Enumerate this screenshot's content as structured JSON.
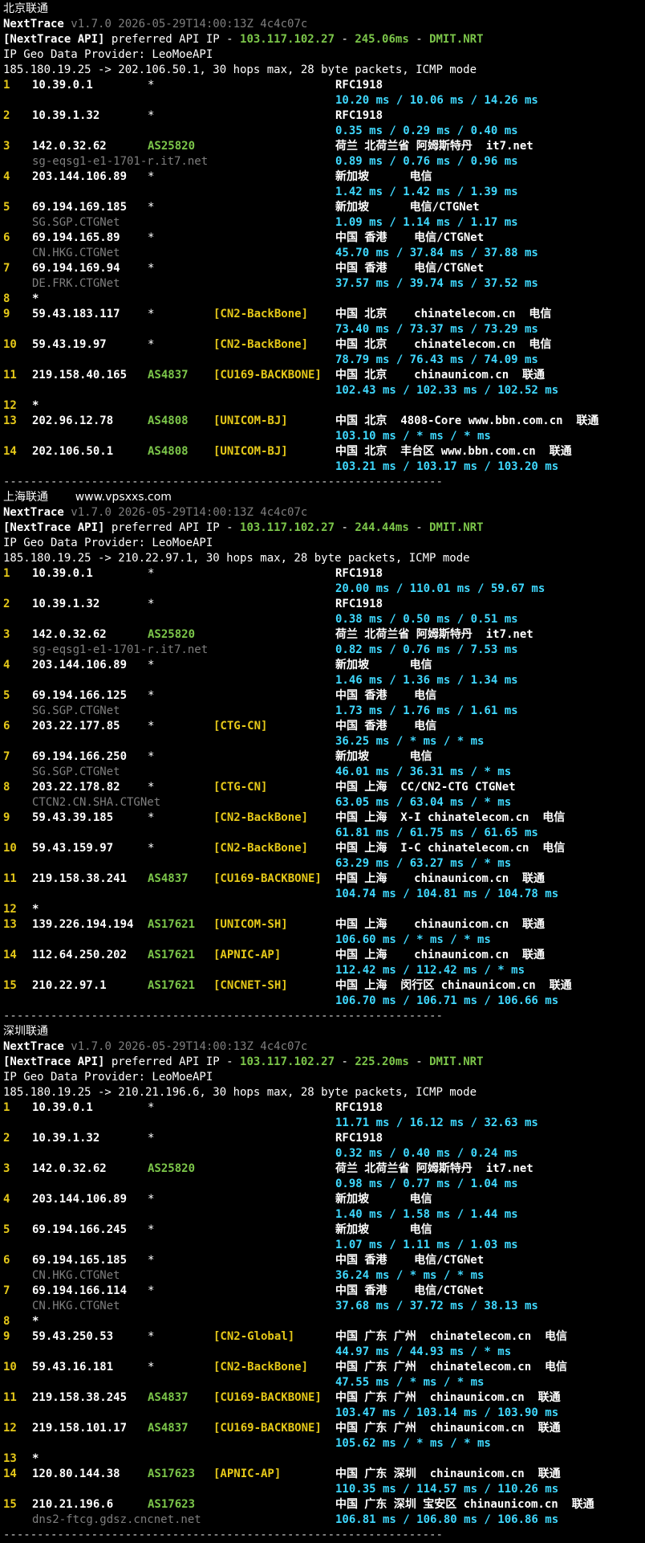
{
  "sections": [
    {
      "title": "北京联通",
      "title_extra": "",
      "nt_name": "NextTrace",
      "nt_version": "v1.7.0 2026-05-29T14:00:13Z 4c4c07c",
      "api_prefix": "[NextTrace API]",
      "api_mid": " preferred API IP - ",
      "api_ip": "103.117.102.27",
      "api_dash1": " - ",
      "api_latency": "245.06ms",
      "api_dash2": " - ",
      "api_node": "DMIT.NRT",
      "geo_provider": "IP Geo Data Provider: LeoMoeAPI",
      "trace_line": "185.180.19.25 -> 202.106.50.1, 30 hops max, 28 byte packets, ICMP mode",
      "hops": [
        {
          "n": "1",
          "ip": "10.39.0.1",
          "as": "*",
          "tag": "",
          "geo": "RFC1918",
          "host": "",
          "rtt": "10.20 ms / 10.06 ms / 14.26 ms"
        },
        {
          "n": "2",
          "ip": "10.39.1.32",
          "as": "*",
          "tag": "",
          "geo": "RFC1918",
          "host": "",
          "rtt": "0.35 ms / 0.29 ms / 0.40 ms"
        },
        {
          "n": "3",
          "ip": "142.0.32.62",
          "as": "AS25820",
          "tag": "",
          "geo": "荷兰 北荷兰省 阿姆斯特丹  it7.net",
          "host": "sg-eqsg1-e1-1701-r.it7.net",
          "rtt": "0.89 ms / 0.76 ms / 0.96 ms"
        },
        {
          "n": "4",
          "ip": "203.144.106.89",
          "as": "*",
          "tag": "",
          "geo": "新加坡      电信",
          "host": "",
          "rtt": "1.42 ms / 1.42 ms / 1.39 ms"
        },
        {
          "n": "5",
          "ip": "69.194.169.185",
          "as": "*",
          "tag": "",
          "geo": "新加坡      电信/CTGNet",
          "host": "SG.SGP.CTGNet",
          "rtt": "1.09 ms / 1.14 ms / 1.17 ms"
        },
        {
          "n": "6",
          "ip": "69.194.165.89",
          "as": "*",
          "tag": "",
          "geo": "中国 香港    电信/CTGNet",
          "host": "CN.HKG.CTGNet",
          "rtt": "45.70 ms / 37.84 ms / 37.88 ms"
        },
        {
          "n": "7",
          "ip": "69.194.169.94",
          "as": "*",
          "tag": "",
          "geo": "中国 香港    电信/CTGNet",
          "host": "DE.FRK.CTGNet",
          "rtt": "37.57 ms / 39.74 ms / 37.52 ms"
        },
        {
          "n": "8",
          "ip": "*",
          "as": "",
          "tag": "",
          "geo": "",
          "host": "",
          "rtt": ""
        },
        {
          "n": "9",
          "ip": "59.43.183.117",
          "as": "*",
          "tag": "[CN2-BackBone]",
          "geo": "中国 北京    chinatelecom.cn  电信",
          "host": "",
          "rtt": "73.40 ms / 73.37 ms / 73.29 ms"
        },
        {
          "n": "10",
          "ip": "59.43.19.97",
          "as": "*",
          "tag": "[CN2-BackBone]",
          "geo": "中国 北京    chinatelecom.cn  电信",
          "host": "",
          "rtt": "78.79 ms / 76.43 ms / 74.09 ms"
        },
        {
          "n": "11",
          "ip": "219.158.40.165",
          "as": "AS4837",
          "tag": "[CU169-BACKBONE]",
          "geo": "中国 北京    chinaunicom.cn  联通",
          "host": "",
          "rtt": "102.43 ms / 102.33 ms / 102.52 ms"
        },
        {
          "n": "12",
          "ip": "*",
          "as": "",
          "tag": "",
          "geo": "",
          "host": "",
          "rtt": ""
        },
        {
          "n": "13",
          "ip": "202.96.12.78",
          "as": "AS4808",
          "tag": "[UNICOM-BJ]",
          "geo": "中国 北京  4808-Core www.bbn.com.cn  联通",
          "host": "",
          "rtt": "103.10 ms / * ms / * ms"
        },
        {
          "n": "14",
          "ip": "202.106.50.1",
          "as": "AS4808",
          "tag": "[UNICOM-BJ]",
          "geo": "中国 北京  丰台区 www.bbn.com.cn  联通",
          "host": "",
          "rtt": "103.21 ms / 103.17 ms / 103.20 ms"
        }
      ]
    },
    {
      "title": "上海联通",
      "title_extra": "www.vpsxxs.com",
      "nt_name": "NextTrace",
      "nt_version": "v1.7.0 2026-05-29T14:00:13Z 4c4c07c",
      "api_prefix": "[NextTrace API]",
      "api_mid": " preferred API IP - ",
      "api_ip": "103.117.102.27",
      "api_dash1": " - ",
      "api_latency": "244.44ms",
      "api_dash2": " - ",
      "api_node": "DMIT.NRT",
      "geo_provider": "IP Geo Data Provider: LeoMoeAPI",
      "trace_line": "185.180.19.25 -> 210.22.97.1, 30 hops max, 28 byte packets, ICMP mode",
      "hops": [
        {
          "n": "1",
          "ip": "10.39.0.1",
          "as": "*",
          "tag": "",
          "geo": "RFC1918",
          "host": "",
          "rtt": "20.00 ms / 110.01 ms / 59.67 ms"
        },
        {
          "n": "2",
          "ip": "10.39.1.32",
          "as": "*",
          "tag": "",
          "geo": "RFC1918",
          "host": "",
          "rtt": "0.38 ms / 0.50 ms / 0.51 ms"
        },
        {
          "n": "3",
          "ip": "142.0.32.62",
          "as": "AS25820",
          "tag": "",
          "geo": "荷兰 北荷兰省 阿姆斯特丹  it7.net",
          "host": "sg-eqsg1-e1-1701-r.it7.net",
          "rtt": "0.82 ms / 0.76 ms / 7.53 ms"
        },
        {
          "n": "4",
          "ip": "203.144.106.89",
          "as": "*",
          "tag": "",
          "geo": "新加坡      电信",
          "host": "",
          "rtt": "1.46 ms / 1.36 ms / 1.34 ms"
        },
        {
          "n": "5",
          "ip": "69.194.166.125",
          "as": "*",
          "tag": "",
          "geo": "中国 香港    电信",
          "host": "SG.SGP.CTGNet",
          "rtt": "1.73 ms / 1.76 ms / 1.61 ms"
        },
        {
          "n": "6",
          "ip": "203.22.177.85",
          "as": "*",
          "tag": "[CTG-CN]",
          "geo": "中国 香港    电信",
          "host": "",
          "rtt": "36.25 ms / * ms / * ms"
        },
        {
          "n": "7",
          "ip": "69.194.166.250",
          "as": "*",
          "tag": "",
          "geo": "新加坡      电信",
          "host": "SG.SGP.CTGNet",
          "rtt": "46.01 ms / 36.31 ms / * ms"
        },
        {
          "n": "8",
          "ip": "203.22.178.82",
          "as": "*",
          "tag": "[CTG-CN]",
          "geo": "中国 上海  CC/CN2-CTG CTGNet",
          "host": "CTCN2.CN.SHA.CTGNet",
          "rtt": "63.05 ms / 63.04 ms / * ms"
        },
        {
          "n": "9",
          "ip": "59.43.39.185",
          "as": "*",
          "tag": "[CN2-BackBone]",
          "geo": "中国 上海  X-I chinatelecom.cn  电信",
          "host": "",
          "rtt": "61.81 ms / 61.75 ms / 61.65 ms"
        },
        {
          "n": "10",
          "ip": "59.43.159.97",
          "as": "*",
          "tag": "[CN2-BackBone]",
          "geo": "中国 上海  I-C chinatelecom.cn  电信",
          "host": "",
          "rtt": "63.29 ms / 63.27 ms / * ms"
        },
        {
          "n": "11",
          "ip": "219.158.38.241",
          "as": "AS4837",
          "tag": "[CU169-BACKBONE]",
          "geo": "中国 上海    chinaunicom.cn  联通",
          "host": "",
          "rtt": "104.74 ms / 104.81 ms / 104.78 ms"
        },
        {
          "n": "12",
          "ip": "*",
          "as": "",
          "tag": "",
          "geo": "",
          "host": "",
          "rtt": ""
        },
        {
          "n": "13",
          "ip": "139.226.194.194",
          "as": "AS17621",
          "tag": "[UNICOM-SH]",
          "geo": "中国 上海    chinaunicom.cn  联通",
          "host": "",
          "rtt": "106.60 ms / * ms / * ms"
        },
        {
          "n": "14",
          "ip": "112.64.250.202",
          "as": "AS17621",
          "tag": "[APNIC-AP]",
          "geo": "中国 上海    chinaunicom.cn  联通",
          "host": "",
          "rtt": "112.42 ms / 112.42 ms / * ms"
        },
        {
          "n": "15",
          "ip": "210.22.97.1",
          "as": "AS17621",
          "tag": "[CNCNET-SH]",
          "geo": "中国 上海  闵行区 chinaunicom.cn  联通",
          "host": "",
          "rtt": "106.70 ms / 106.71 ms / 106.66 ms"
        }
      ]
    },
    {
      "title": "深圳联通",
      "title_extra": "",
      "nt_name": "NextTrace",
      "nt_version": "v1.7.0 2026-05-29T14:00:13Z 4c4c07c",
      "api_prefix": "[NextTrace API]",
      "api_mid": " preferred API IP - ",
      "api_ip": "103.117.102.27",
      "api_dash1": " - ",
      "api_latency": "225.20ms",
      "api_dash2": " - ",
      "api_node": "DMIT.NRT",
      "geo_provider": "IP Geo Data Provider: LeoMoeAPI",
      "trace_line": "185.180.19.25 -> 210.21.196.6, 30 hops max, 28 byte packets, ICMP mode",
      "hops": [
        {
          "n": "1",
          "ip": "10.39.0.1",
          "as": "*",
          "tag": "",
          "geo": "RFC1918",
          "host": "",
          "rtt": "11.71 ms / 16.12 ms / 32.63 ms"
        },
        {
          "n": "2",
          "ip": "10.39.1.32",
          "as": "*",
          "tag": "",
          "geo": "RFC1918",
          "host": "",
          "rtt": "0.32 ms / 0.40 ms / 0.24 ms"
        },
        {
          "n": "3",
          "ip": "142.0.32.62",
          "as": "AS25820",
          "tag": "",
          "geo": "荷兰 北荷兰省 阿姆斯特丹  it7.net",
          "host": "",
          "rtt": "0.98 ms / 0.77 ms / 1.04 ms"
        },
        {
          "n": "4",
          "ip": "203.144.106.89",
          "as": "*",
          "tag": "",
          "geo": "新加坡      电信",
          "host": "",
          "rtt": "1.40 ms / 1.58 ms / 1.44 ms"
        },
        {
          "n": "5",
          "ip": "69.194.166.245",
          "as": "*",
          "tag": "",
          "geo": "新加坡      电信",
          "host": "",
          "rtt": "1.07 ms / 1.11 ms / 1.03 ms"
        },
        {
          "n": "6",
          "ip": "69.194.165.185",
          "as": "*",
          "tag": "",
          "geo": "中国 香港    电信/CTGNet",
          "host": "CN.HKG.CTGNet",
          "rtt": "36.24 ms / * ms / * ms"
        },
        {
          "n": "7",
          "ip": "69.194.166.114",
          "as": "*",
          "tag": "",
          "geo": "中国 香港    电信/CTGNet",
          "host": "CN.HKG.CTGNet",
          "rtt": "37.68 ms / 37.72 ms / 38.13 ms"
        },
        {
          "n": "8",
          "ip": "*",
          "as": "",
          "tag": "",
          "geo": "",
          "host": "",
          "rtt": ""
        },
        {
          "n": "9",
          "ip": "59.43.250.53",
          "as": "*",
          "tag": "[CN2-Global]",
          "geo": "中国 广东 广州  chinatelecom.cn  电信",
          "host": "",
          "rtt": "44.97 ms / 44.93 ms / * ms"
        },
        {
          "n": "10",
          "ip": "59.43.16.181",
          "as": "*",
          "tag": "[CN2-BackBone]",
          "geo": "中国 广东 广州  chinatelecom.cn  电信",
          "host": "",
          "rtt": "47.55 ms / * ms / * ms"
        },
        {
          "n": "11",
          "ip": "219.158.38.245",
          "as": "AS4837",
          "tag": "[CU169-BACKBONE]",
          "geo": "中国 广东 广州  chinaunicom.cn  联通",
          "host": "",
          "rtt": "103.47 ms / 103.14 ms / 103.90 ms"
        },
        {
          "n": "12",
          "ip": "219.158.101.17",
          "as": "AS4837",
          "tag": "[CU169-BACKBONE]",
          "geo": "中国 广东 广州  chinaunicom.cn  联通",
          "host": "",
          "rtt": "105.62 ms / * ms / * ms"
        },
        {
          "n": "13",
          "ip": "*",
          "as": "",
          "tag": "",
          "geo": "",
          "host": "",
          "rtt": ""
        },
        {
          "n": "14",
          "ip": "120.80.144.38",
          "as": "AS17623",
          "tag": "[APNIC-AP]",
          "geo": "中国 广东 深圳  chinaunicom.cn  联通",
          "host": "",
          "rtt": "110.35 ms / 114.57 ms / 110.26 ms"
        },
        {
          "n": "15",
          "ip": "210.21.196.6",
          "as": "AS17623",
          "tag": "",
          "geo": "中国 广东 深圳 宝安区 chinaunicom.cn  联通",
          "host": "dns2-ftcg.gdsz.cncnet.net",
          "rtt": "106.81 ms / 106.80 ms / 106.86 ms"
        }
      ]
    }
  ],
  "separator": "-----------------------------------------------------------------"
}
